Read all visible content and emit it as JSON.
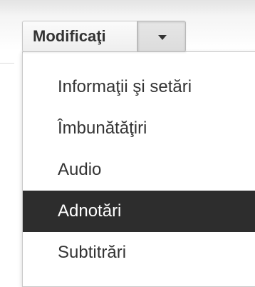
{
  "toolbar": {
    "edit_label": "Modificaţi",
    "dropdown_icon": "chevron-down-icon"
  },
  "menu": {
    "items": [
      {
        "label": "Informaţii şi setări",
        "selected": false
      },
      {
        "label": "Îmbunătăţiri",
        "selected": false
      },
      {
        "label": "Audio",
        "selected": false
      },
      {
        "label": "Adnotări",
        "selected": true
      },
      {
        "label": "Subtitrări",
        "selected": false
      }
    ]
  },
  "colors": {
    "selected_background": "#2d2d2d",
    "selected_text": "#ffffff",
    "text": "#333333"
  }
}
